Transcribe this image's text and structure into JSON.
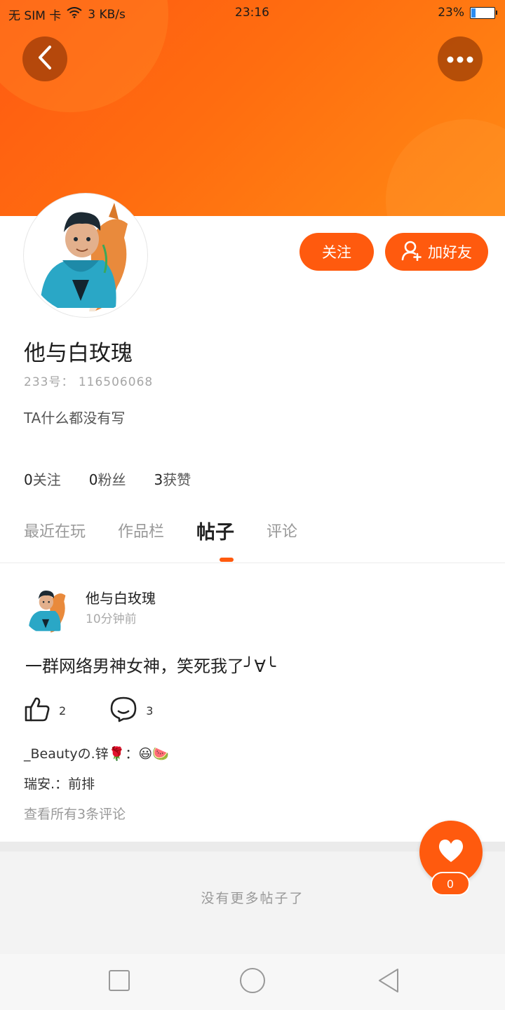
{
  "status_bar": {
    "carrier": "无 SIM 卡",
    "speed": "3 KB/s",
    "time": "23:16",
    "battery": "23%"
  },
  "header": {
    "back_icon": "chevron-left-icon",
    "more_icon": "more-dots-icon"
  },
  "profile": {
    "username": "他与白玫瑰",
    "uid": "233号： 116506068",
    "bio": "TA什么都没有写",
    "follow_label": "关注",
    "add_friend_label": "加好友",
    "stats": [
      {
        "num": "0",
        "label": "关注"
      },
      {
        "num": "0",
        "label": "粉丝"
      },
      {
        "num": "3",
        "label": "获赞"
      }
    ]
  },
  "tabs": [
    {
      "label": "最近在玩",
      "active": false
    },
    {
      "label": "作品栏",
      "active": false
    },
    {
      "label": "帖子",
      "active": true
    },
    {
      "label": "评论",
      "active": false
    }
  ],
  "post": {
    "user": "他与白玫瑰",
    "time": "10分钟前",
    "text": "一群网络男神女神，笑死我了╯∀╰",
    "likes": "2",
    "comments": "3",
    "comment_list": [
      {
        "name": "_Beautyの.锌🌹",
        "sep": "：",
        "text": "😃🍉"
      },
      {
        "name": "瑞安.",
        "sep": "：",
        "text": "前排"
      }
    ],
    "view_all": "查看所有3条评论"
  },
  "footer": {
    "no_more": "没有更多帖子了",
    "like_fab_count": "0"
  },
  "colors": {
    "accent": "#ff5a0e",
    "banner_start": "#ff5a12",
    "banner_end": "#ff8a14"
  }
}
